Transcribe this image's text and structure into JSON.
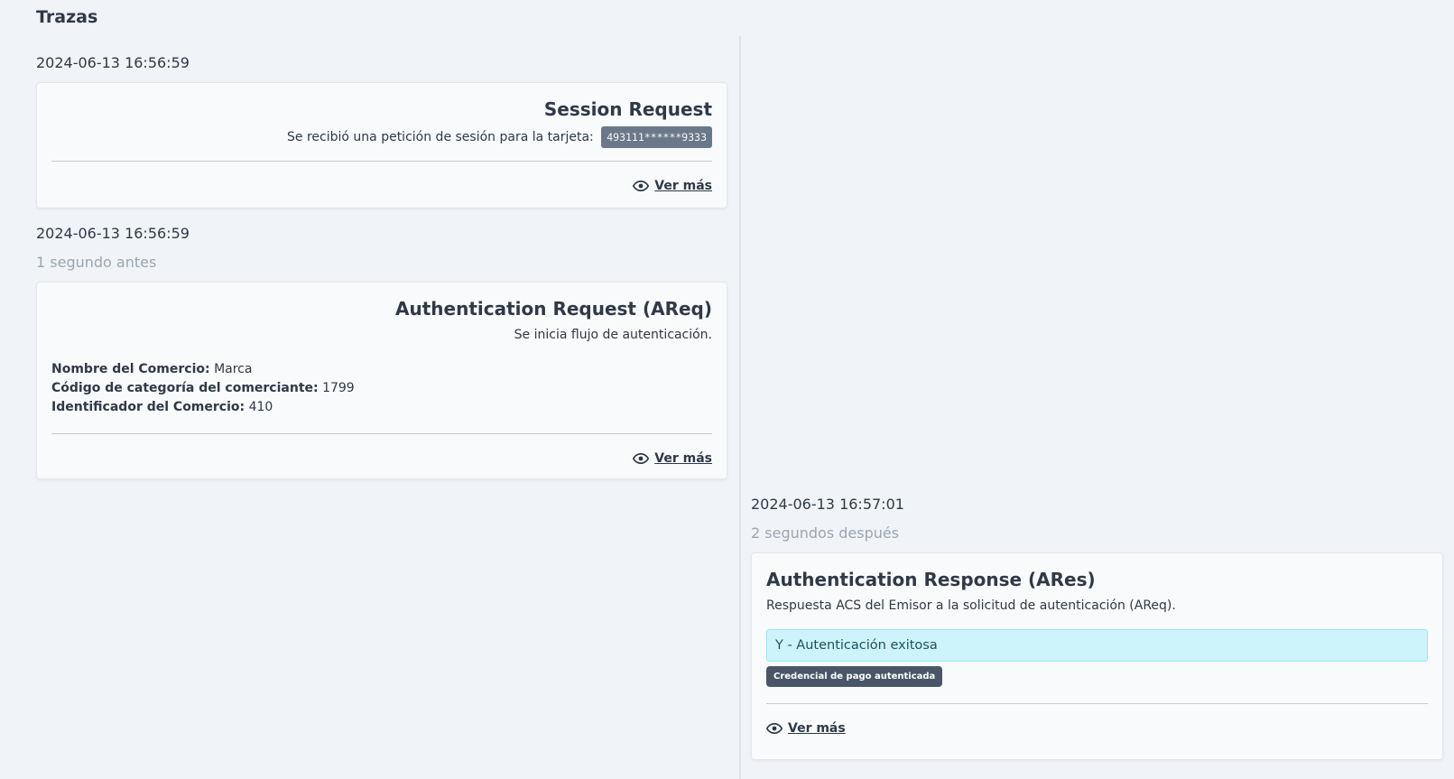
{
  "page": {
    "title": "Trazas"
  },
  "traces": [
    {
      "timestamp": "2024-06-13 16:56:59",
      "title": "Session Request",
      "description": "Se recibió una petición de sesión para la tarjeta:",
      "card_number": "493111******9333",
      "ver_mas": "Ver más"
    },
    {
      "timestamp": "2024-06-13 16:56:59",
      "relative": "1 segundo antes",
      "title": "Authentication Request (AReq)",
      "description": "Se inicia flujo de autenticación.",
      "fields": [
        {
          "label": "Nombre del Comercio:",
          "value": "Marca"
        },
        {
          "label": "Código de categoría del comerciante:",
          "value": "1799"
        },
        {
          "label": "Identificador del Comercio:",
          "value": "410"
        }
      ],
      "ver_mas": "Ver más"
    },
    {
      "timestamp": "2024-06-13 16:57:01",
      "relative": "2 segundos después",
      "title": "Authentication Response (ARes)",
      "description": "Respuesta ACS del Emisor a la solicitud de autenticación (AReq).",
      "status": "Y - Autenticación exitosa",
      "status_badge": "Credencial de pago autenticada",
      "ver_mas": "Ver más"
    }
  ],
  "colors": {
    "background": "#f0f3f7",
    "card": "#f8fafc",
    "text": "#2f3947",
    "muted": "#9aa6b2",
    "info_alert": "#cdf4fb",
    "badge_dark": "#4a5668"
  },
  "icons": {
    "ver_mas": "eye-icon"
  }
}
